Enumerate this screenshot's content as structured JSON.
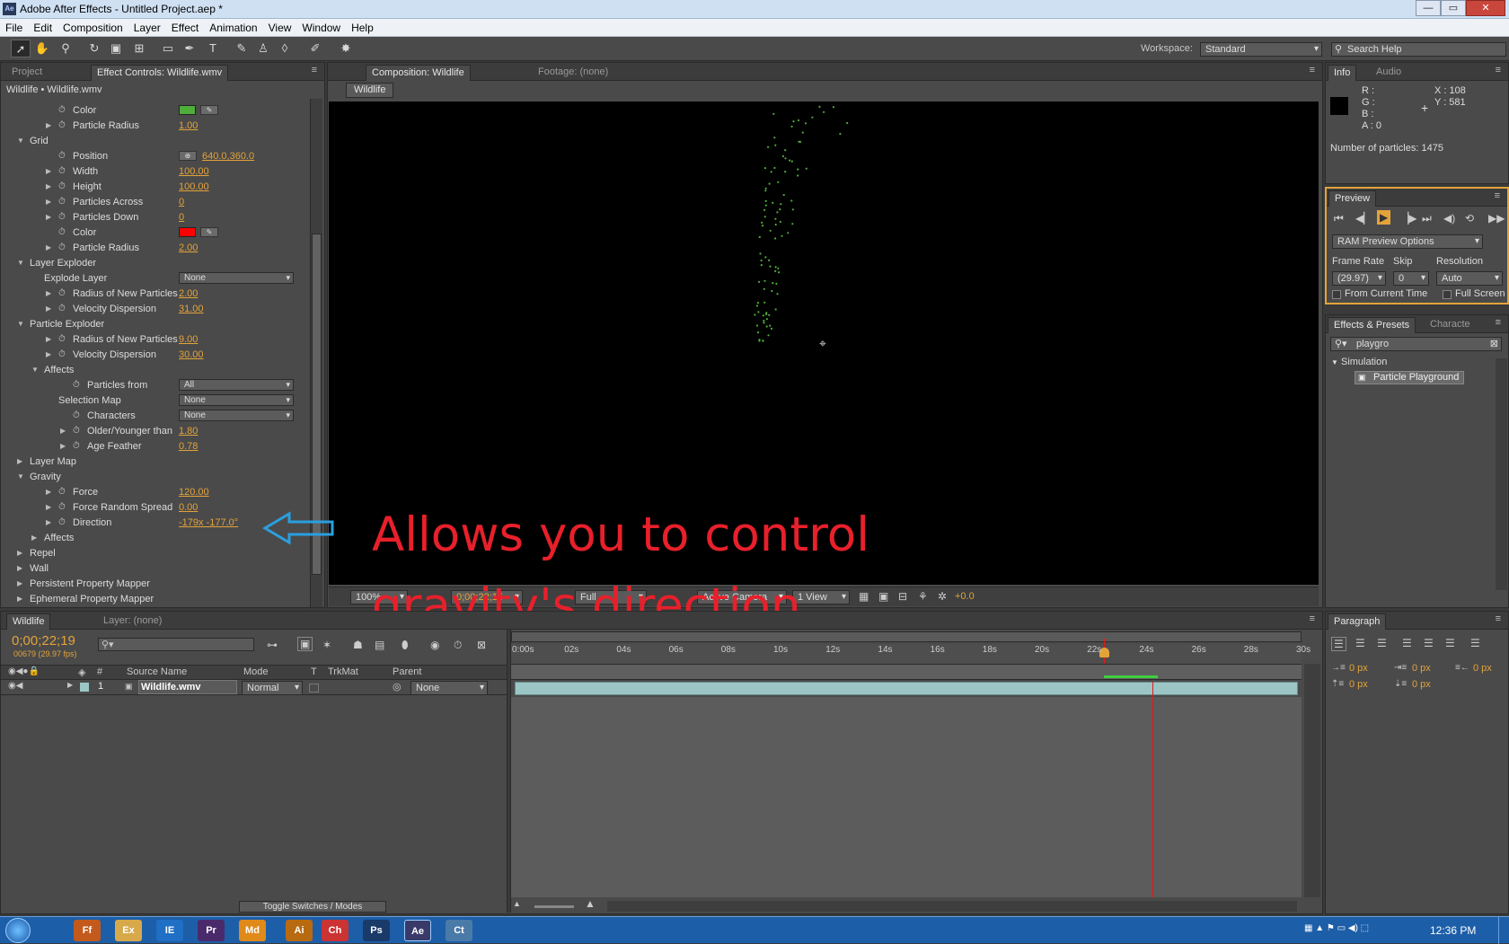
{
  "window": {
    "title": "Adobe After Effects - Untitled Project.aep *",
    "app_icon": "Ae",
    "minimize": "—",
    "maximize": "▭",
    "close": "✕"
  },
  "menu": [
    "File",
    "Edit",
    "Composition",
    "Layer",
    "Effect",
    "Animation",
    "View",
    "Window",
    "Help"
  ],
  "toolbar": {
    "workspace_label": "Workspace:",
    "workspace_value": "Standard",
    "search_placeholder": "Search Help"
  },
  "left_panel": {
    "tabs": [
      "Project",
      "Effect Controls: Wildlife.wmv"
    ],
    "breadcrumb": "Wildlife • Wildlife.wmv",
    "rows": [
      {
        "label": "Color",
        "indent": 2,
        "stopwatch": true,
        "color": "#4fae3a"
      },
      {
        "label": "Particle Radius",
        "indent": 2,
        "twirl": "right",
        "stopwatch": true,
        "value": "1.00"
      },
      {
        "label": "Grid",
        "indent": 0,
        "twirl": "down"
      },
      {
        "label": "Position",
        "indent": 2,
        "stopwatch": true,
        "value": "640.0,360.0",
        "target": true
      },
      {
        "label": "Width",
        "indent": 2,
        "twirl": "right",
        "stopwatch": true,
        "value": "100.00"
      },
      {
        "label": "Height",
        "indent": 2,
        "twirl": "right",
        "stopwatch": true,
        "value": "100.00"
      },
      {
        "label": "Particles Across",
        "indent": 2,
        "twirl": "right",
        "stopwatch": true,
        "value": "0"
      },
      {
        "label": "Particles Down",
        "indent": 2,
        "twirl": "right",
        "stopwatch": true,
        "value": "0"
      },
      {
        "label": "Color",
        "indent": 2,
        "stopwatch": true,
        "color": "#ff0000"
      },
      {
        "label": "Particle Radius",
        "indent": 2,
        "twirl": "right",
        "stopwatch": true,
        "value": "2.00"
      },
      {
        "label": "Layer Exploder",
        "indent": 0,
        "twirl": "down"
      },
      {
        "label": "Explode Layer",
        "indent": 1,
        "dropdown": "None"
      },
      {
        "label": "Radius of New Particles",
        "indent": 2,
        "twirl": "right",
        "stopwatch": true,
        "value": "2.00"
      },
      {
        "label": "Velocity Dispersion",
        "indent": 2,
        "twirl": "right",
        "stopwatch": true,
        "value": "31.00"
      },
      {
        "label": "Particle Exploder",
        "indent": 0,
        "twirl": "down"
      },
      {
        "label": "Radius of New Particles",
        "indent": 2,
        "twirl": "right",
        "stopwatch": true,
        "value": "9.00"
      },
      {
        "label": "Velocity Dispersion",
        "indent": 2,
        "twirl": "right",
        "stopwatch": true,
        "value": "30.00"
      },
      {
        "label": "Affects",
        "indent": 1,
        "twirl": "down"
      },
      {
        "label": "Particles from",
        "indent": 3,
        "stopwatch": true,
        "dropdown": "All"
      },
      {
        "label": "Selection Map",
        "indent": 2,
        "dropdown": "None"
      },
      {
        "label": "Characters",
        "indent": 3,
        "stopwatch": true,
        "dropdown": "None"
      },
      {
        "label": "Older/Younger than",
        "indent": 3,
        "twirl": "right",
        "stopwatch": true,
        "value": "1.80"
      },
      {
        "label": "Age Feather",
        "indent": 3,
        "twirl": "right",
        "stopwatch": true,
        "value": "0.78"
      },
      {
        "label": "Layer Map",
        "indent": 0,
        "twirl": "right"
      },
      {
        "label": "Gravity",
        "indent": 0,
        "twirl": "down"
      },
      {
        "label": "Force",
        "indent": 2,
        "twirl": "right",
        "stopwatch": true,
        "value": "120.00"
      },
      {
        "label": "Force Random Spread",
        "indent": 2,
        "twirl": "right",
        "stopwatch": true,
        "value": "0.00"
      },
      {
        "label": "Direction",
        "indent": 2,
        "twirl": "right",
        "stopwatch": true,
        "value": "-179x -177.0°"
      },
      {
        "label": "Affects",
        "indent": 1,
        "twirl": "right"
      },
      {
        "label": "Repel",
        "indent": 0,
        "twirl": "right"
      },
      {
        "label": "Wall",
        "indent": 0,
        "twirl": "right"
      },
      {
        "label": "Persistent Property Mapper",
        "indent": 0,
        "twirl": "right"
      },
      {
        "label": "Ephemeral Property Mapper",
        "indent": 0,
        "twirl": "right"
      }
    ]
  },
  "comp_panel": {
    "tabs": [
      "Composition: Wildlife",
      "Footage: (none)"
    ],
    "chip": "Wildlife",
    "footer": {
      "zoom": "100%",
      "time": "0;00;22;15",
      "quality": "Full",
      "camera": "Active Camera",
      "views": "1 View",
      "exposure": "+0.0"
    }
  },
  "annotation": {
    "line1": "Allows you to control",
    "line2": "gravity's direction",
    "color": "#e8202b",
    "arrow_color": "#2a9fe0"
  },
  "info_panel": {
    "tabs": [
      "Info",
      "Audio"
    ],
    "r": "R :",
    "g": "G :",
    "b": "B :",
    "a": "A : 0",
    "x": "X : 108",
    "y": "Y : 581",
    "particles": "Number of particles: 1475"
  },
  "preview_panel": {
    "tab": "Preview",
    "ram_preview": "RAM Preview Options",
    "frame_rate_label": "Frame Rate",
    "skip_label": "Skip",
    "resolution_label": "Resolution",
    "frame_rate": "(29.97)",
    "skip": "0",
    "resolution": "Auto",
    "from_current": "From Current Time",
    "full_screen": "Full Screen"
  },
  "effects_panel": {
    "tabs": [
      "Effects & Presets",
      "Characte"
    ],
    "search_value": "playgro",
    "category": "Simulation",
    "item": "Particle Playground"
  },
  "timeline": {
    "tabs": [
      "Wildlife",
      "Layer: (none)"
    ],
    "timecode": "0;00;22;19",
    "frame_info": "00679 (29.97 fps)",
    "columns": {
      "num": "#",
      "source": "Source Name",
      "mode": "Mode",
      "t": "T",
      "trkmat": "TrkMat",
      "parent": "Parent"
    },
    "layer": {
      "num": "1",
      "name": "Wildlife.wmv",
      "mode": "Normal",
      "parent": "None"
    },
    "ruler": [
      "0:00s",
      "02s",
      "04s",
      "06s",
      "08s",
      "10s",
      "12s",
      "14s",
      "16s",
      "18s",
      "20s",
      "22s",
      "24s",
      "26s",
      "28s",
      "30s"
    ],
    "toggle_label": "Toggle Switches / Modes"
  },
  "paragraph_panel": {
    "tab": "Paragraph",
    "fields": [
      "0 px",
      "0 px",
      "0 px",
      "0 px",
      "0 px"
    ]
  },
  "taskbar": {
    "clock": "12:36 PM",
    "apps": [
      "Ff",
      "Ex",
      "IE",
      "Pr",
      "Md",
      "Ai",
      "Ch",
      "Ps",
      "Ae",
      "Ct"
    ]
  }
}
